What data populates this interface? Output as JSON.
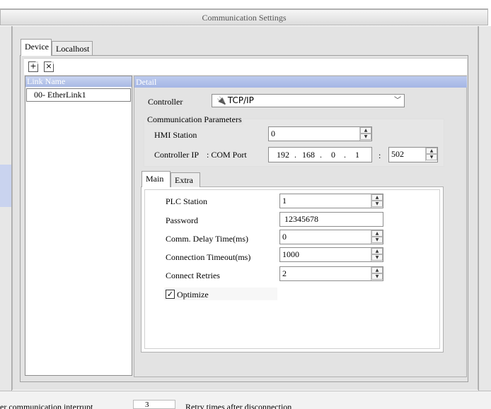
{
  "window": {
    "title": "Communication Settings"
  },
  "tabs": {
    "device": "Device",
    "localhost": "Localhost"
  },
  "toolbar": {
    "add_glyph": "+",
    "delete_glyph": "×"
  },
  "link_list": {
    "header": "Link Name",
    "items": [
      "00- EtherLink1"
    ]
  },
  "detail": {
    "header": "Detail",
    "controller_label": "Controller",
    "controller_value": "TCP/IP",
    "comm_group_label": "Communication Parameters",
    "hmi_station_label": "HMI Station",
    "hmi_station_value": "0",
    "controller_ip_label": "Controller IP",
    "com_port_label": ": COM Port",
    "ip": [
      "192",
      "168",
      "0",
      "1"
    ],
    "ip_sep": ".",
    "port_sep": ":",
    "port_value": "502"
  },
  "inner_tabs": {
    "main": "Main",
    "extra": "Extra"
  },
  "main": {
    "plc_station_label": "PLC Station",
    "plc_station_value": "1",
    "password_label": "Password",
    "password_value": "12345678",
    "comm_delay_label": "Comm. Delay Time(ms)",
    "comm_delay_value": "0",
    "conn_timeout_label": "Connection Timeout(ms)",
    "conn_timeout_value": "1000",
    "connect_retries_label": "Connect Retries",
    "connect_retries_value": "2",
    "optimize_label": "Optimize",
    "optimize_checked": true
  },
  "bottom": {
    "left_text": "er communication interrupt",
    "spin_value": "3",
    "right_text": "Retry times after disconnection"
  }
}
